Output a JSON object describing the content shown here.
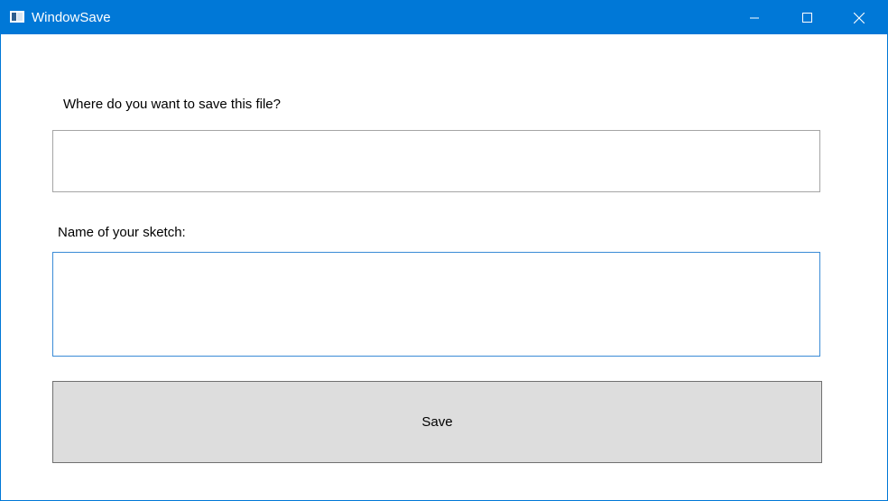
{
  "window": {
    "title": "WindowSave",
    "accent_color": "#0078d7",
    "icons": {
      "app": "window-app-icon",
      "minimize": "minimize-icon",
      "maximize": "maximize-icon",
      "close": "close-icon"
    }
  },
  "form": {
    "location_label": "Where do you want to save this file?",
    "location_value": "",
    "name_label": "Name of your sketch:",
    "name_value": "",
    "save_label": "Save"
  }
}
